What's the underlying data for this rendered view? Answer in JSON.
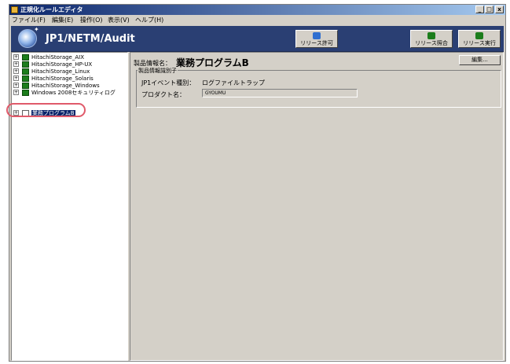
{
  "window": {
    "title": "正規化ルールエディタ",
    "controls": {
      "minimize": "_",
      "maximize": "□",
      "close": "x"
    }
  },
  "menu": [
    {
      "label": "ファイル(F)"
    },
    {
      "label": "編集(E)"
    },
    {
      "label": "操作(O)"
    },
    {
      "label": "表示(V)"
    },
    {
      "label": "ヘルプ(H)"
    }
  ],
  "header": {
    "product": "JP1/NETM/Audit",
    "buttons": [
      {
        "label": "リリース許可",
        "icon": "release-permit-icon"
      },
      {
        "label": "リリース照合",
        "icon": "release-check-icon"
      },
      {
        "label": "リリース実行",
        "icon": "release-run-icon"
      }
    ]
  },
  "tree": {
    "items": [
      {
        "label": "HitachiStorage_AIX",
        "icon": "product-icon"
      },
      {
        "label": "HitachiStorage_HP-UX",
        "icon": "product-icon"
      },
      {
        "label": "HitachiStorage_Linux",
        "icon": "product-icon"
      },
      {
        "label": "HitachiStorage_Solaris",
        "icon": "product-icon"
      },
      {
        "label": "HitachiStorage_Windows",
        "icon": "product-icon"
      },
      {
        "label": "Windows 2008セキュリティログ",
        "icon": "product-icon"
      },
      {
        "label": "業務プログラムB",
        "icon": "page-icon",
        "selected": true
      }
    ]
  },
  "main": {
    "product_info_label": "製品情報名：",
    "product_info_value": "業務プログラムB",
    "edit_button": "編集...",
    "identifier_group": "製品情報識別子",
    "event_type_label": "JP1イベント種別：",
    "event_type_value": "ログファイルトラップ",
    "product_name_label": "プロダクト名：",
    "product_name_value": "GYOUMU"
  },
  "colors": {
    "header_bg": "#2a3f73",
    "highlight": "#e05a6a",
    "selection": "#0a246a",
    "tree_icon": "#1c7d1c"
  }
}
